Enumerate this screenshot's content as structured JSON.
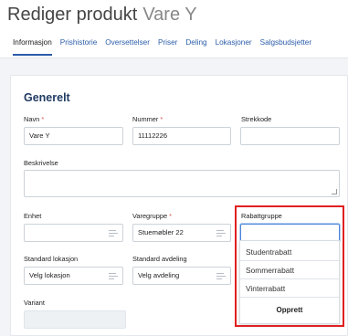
{
  "header": {
    "title_prefix": "Rediger produkt",
    "title_product": "Vare Y",
    "tabs": [
      {
        "label": "Informasjon",
        "active": true
      },
      {
        "label": "Prishistorie",
        "active": false
      },
      {
        "label": "Oversettelser",
        "active": false
      },
      {
        "label": "Priser",
        "active": false
      },
      {
        "label": "Deling",
        "active": false
      },
      {
        "label": "Lokasjoner",
        "active": false
      },
      {
        "label": "Salgsbudsjetter",
        "active": false
      }
    ]
  },
  "section": {
    "title": "Generelt"
  },
  "fields": {
    "navn": {
      "label": "Navn",
      "required_mark": "*",
      "value": "Vare Y"
    },
    "nummer": {
      "label": "Nummer",
      "required_mark": "*",
      "value": "11112226"
    },
    "strekkode": {
      "label": "Strekkode",
      "value": ""
    },
    "beskrivelse": {
      "label": "Beskrivelse",
      "value": ""
    },
    "enhet": {
      "label": "Enhet",
      "value": ""
    },
    "varegruppe": {
      "label": "Varegruppe",
      "required_mark": "*",
      "value": "Stuemøbler 22"
    },
    "rabattgruppe": {
      "label": "Rabattgruppe",
      "value": ""
    },
    "standard_lokasjon": {
      "label": "Standard lokasjon",
      "value": "Velg lokasjon"
    },
    "standard_avdeling": {
      "label": "Standard avdeling",
      "value": "Velg avdeling"
    },
    "variant": {
      "label": "Variant",
      "value": ""
    }
  },
  "dropdown": {
    "options": [
      "Studentrabatt",
      "Sommerrabatt",
      "Vinterrabatt"
    ],
    "create_label": "Opprett"
  },
  "colors": {
    "accent": "#2a5ca8",
    "highlight": "#e02020",
    "required": "#d9534f"
  },
  "icons": {
    "select": "list-select-icon",
    "resize": "resize-handle-icon"
  }
}
